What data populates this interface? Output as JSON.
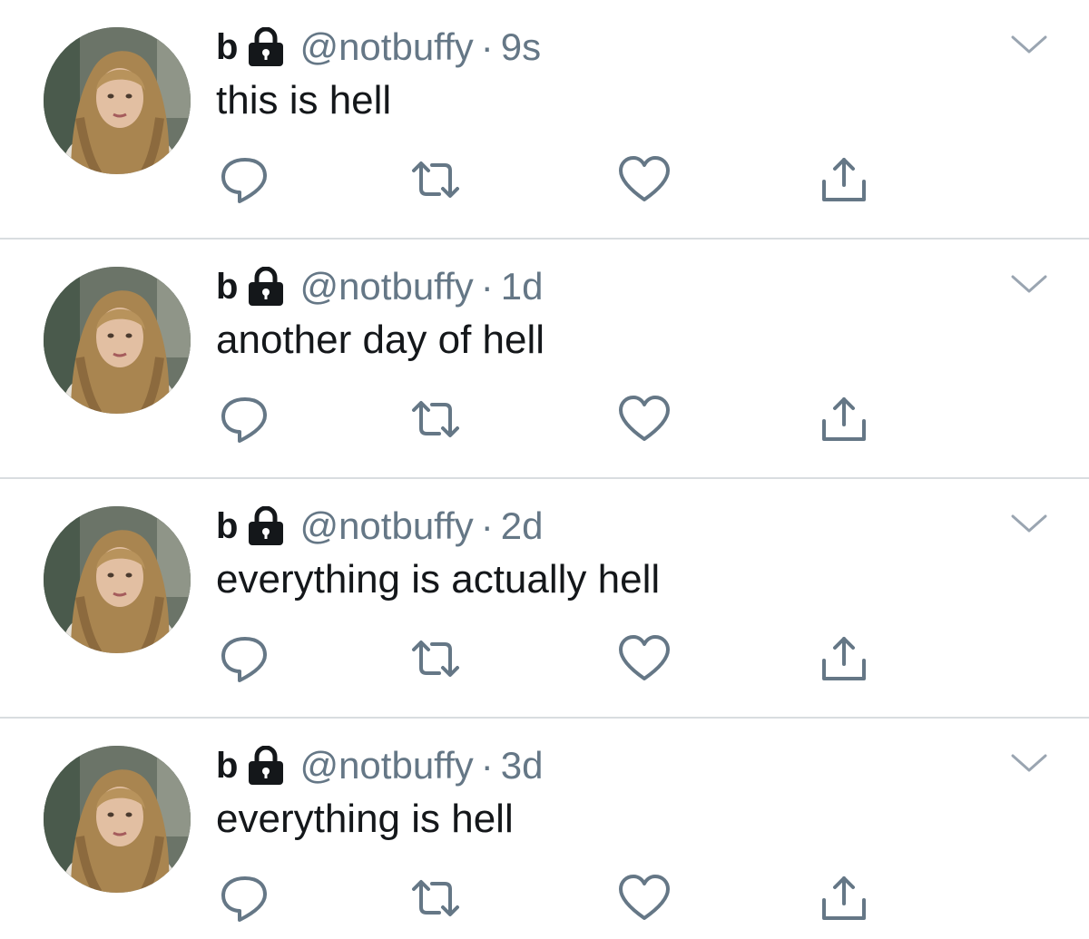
{
  "tweets": [
    {
      "display_name": "b",
      "handle": "@notbuffy",
      "separator": "·",
      "time": "9s",
      "text": "this is hell"
    },
    {
      "display_name": "b",
      "handle": "@notbuffy",
      "separator": "·",
      "time": "1d",
      "text": "another day of hell"
    },
    {
      "display_name": "b",
      "handle": "@notbuffy",
      "separator": "·",
      "time": "2d",
      "text": "everything is actually hell"
    },
    {
      "display_name": "b",
      "handle": "@notbuffy",
      "separator": "·",
      "time": "3d",
      "text": "everything is hell"
    }
  ],
  "icons": {
    "protected": "lock-icon",
    "menu": "chevron-down-icon",
    "reply": "reply-icon",
    "retweet": "retweet-icon",
    "like": "heart-icon",
    "share": "share-icon"
  },
  "colors": {
    "text": "#14171a",
    "secondary": "#657786",
    "divider": "#d9dde0",
    "background": "#ffffff"
  }
}
